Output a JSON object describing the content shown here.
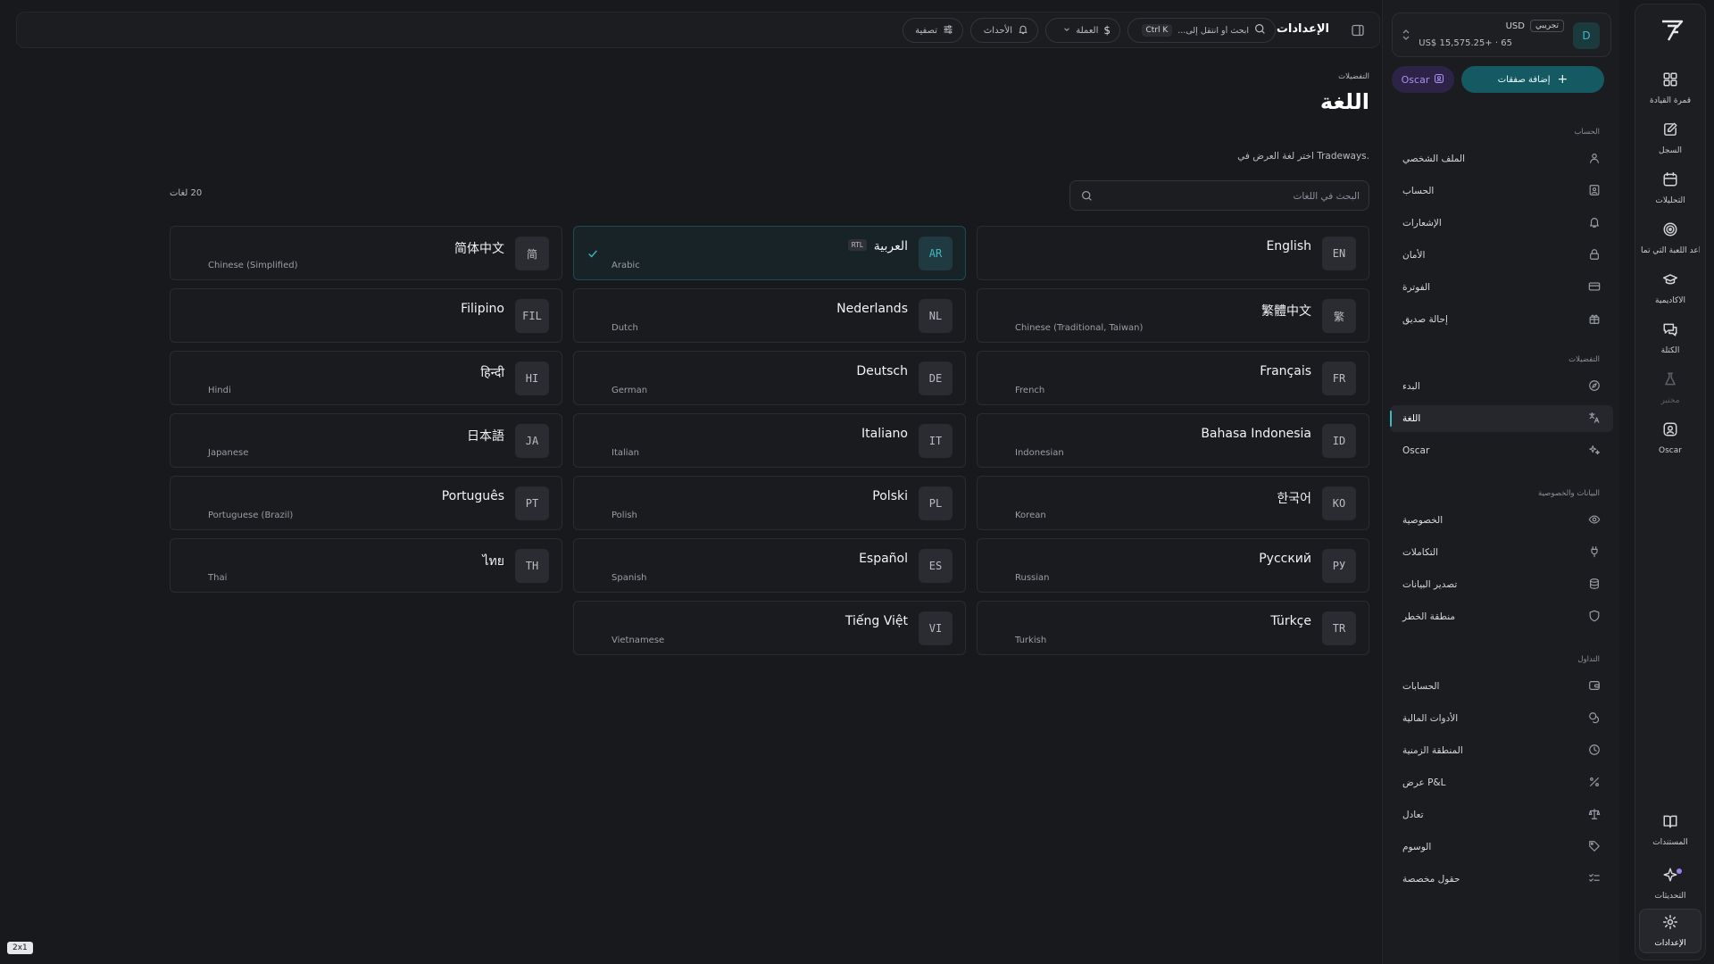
{
  "app": {
    "logo": "tradeways-logo"
  },
  "topbar": {
    "title": "الإعدادات",
    "search_placeholder": "ابحث أو انتقل إلى...",
    "search_shortcut": "Ctrl K",
    "currency_label": "العملة",
    "events_label": "الأحداث",
    "filter_label": "تصفية"
  },
  "rail": {
    "items": [
      {
        "label": "قمرة القيادة",
        "icon": "dashboard-icon"
      },
      {
        "label": "السجل",
        "icon": "journal-icon"
      },
      {
        "label": "التحليلات",
        "icon": "calendar-icon"
      },
      {
        "label": "قواعد اللعبة التي تما...",
        "icon": "target-icon"
      },
      {
        "label": "الأكاديمية",
        "icon": "academy-icon"
      },
      {
        "label": "الكتلة",
        "icon": "chat-icon"
      },
      {
        "label": "مختبر",
        "icon": "flask-icon"
      },
      {
        "label": "Oscar",
        "icon": "oscar-icon"
      }
    ],
    "bottom": [
      {
        "label": "المستندات",
        "icon": "book-icon"
      },
      {
        "label": "التحديثات",
        "icon": "sparkle-icon"
      },
      {
        "label": "الإعدادات",
        "icon": "gear-icon"
      }
    ]
  },
  "account": {
    "avatar": "D",
    "badge": "تجريبي",
    "currency": "USD",
    "balance": "US$ 15,575.25+ · 65"
  },
  "sidebar": {
    "add_trade": "إضافة صفقات",
    "oscar": "Oscar",
    "sections": [
      {
        "title": "الحساب",
        "items": [
          {
            "label": "الملف الشخصي",
            "icon": "user-icon"
          },
          {
            "label": "الحساب",
            "icon": "id-card-icon"
          },
          {
            "label": "الإشعارات",
            "icon": "bell-icon"
          },
          {
            "label": "الأمان",
            "icon": "lock-icon"
          },
          {
            "label": "الفوترة",
            "icon": "credit-card-icon"
          },
          {
            "label": "إحالة صديق",
            "icon": "gift-icon"
          }
        ]
      },
      {
        "title": "التفضيلات",
        "items": [
          {
            "label": "البدء",
            "icon": "compass-icon"
          },
          {
            "label": "اللغة",
            "icon": "translate-icon"
          },
          {
            "label": "Oscar",
            "icon": "sparkles-icon"
          }
        ]
      },
      {
        "title": "البيانات والخصوصية",
        "items": [
          {
            "label": "الخصوصية",
            "icon": "eye-icon"
          },
          {
            "label": "التكاملات",
            "icon": "plug-icon"
          },
          {
            "label": "تصدير البيانات",
            "icon": "database-icon"
          },
          {
            "label": "منطقة الخطر",
            "icon": "shield-icon"
          }
        ]
      },
      {
        "title": "التداول",
        "items": [
          {
            "label": "الحسابات",
            "icon": "wallet-icon"
          },
          {
            "label": "الأدوات المالية",
            "icon": "coins-icon"
          },
          {
            "label": "المنطقة الزمنية",
            "icon": "clock-icon"
          },
          {
            "label": "عرض P&L",
            "icon": "percent-icon"
          },
          {
            "label": "تعادل",
            "icon": "scale-icon"
          },
          {
            "label": "الوسوم",
            "icon": "tag-icon"
          },
          {
            "label": "حقول مخصصة",
            "icon": "list-check-icon"
          }
        ]
      }
    ]
  },
  "main": {
    "breadcrumb": "التفضيلات",
    "title": "اللغة",
    "description": "اختر لغة العرض في Tradeways.",
    "search_placeholder": "البحث في اللغات",
    "count": "20 لغات",
    "rtl_badge": "RTL",
    "languages": [
      {
        "code": "EN",
        "native": "English",
        "english": ""
      },
      {
        "code": "AR",
        "native": "العربية",
        "english": "Arabic",
        "selected": true,
        "rtl": true
      },
      {
        "code": "简",
        "native": "简体中文",
        "english": "Chinese (Simplified)"
      },
      {
        "code": "繁",
        "native": "繁體中文",
        "english": "Chinese (Traditional, Taiwan)"
      },
      {
        "code": "NL",
        "native": "Nederlands",
        "english": "Dutch"
      },
      {
        "code": "FIL",
        "native": "Filipino",
        "english": ""
      },
      {
        "code": "FR",
        "native": "Français",
        "english": "French"
      },
      {
        "code": "DE",
        "native": "Deutsch",
        "english": "German"
      },
      {
        "code": "HI",
        "native": "हिन्दी",
        "english": "Hindi"
      },
      {
        "code": "ID",
        "native": "Bahasa Indonesia",
        "english": "Indonesian"
      },
      {
        "code": "IT",
        "native": "Italiano",
        "english": "Italian"
      },
      {
        "code": "JA",
        "native": "日本語",
        "english": "Japanese"
      },
      {
        "code": "KO",
        "native": "한국어",
        "english": "Korean"
      },
      {
        "code": "PL",
        "native": "Polski",
        "english": "Polish"
      },
      {
        "code": "PT",
        "native": "Português",
        "english": "Portuguese (Brazil)"
      },
      {
        "code": "РУ",
        "native": "Русский",
        "english": "Russian"
      },
      {
        "code": "ES",
        "native": "Español",
        "english": "Spanish"
      },
      {
        "code": "TH",
        "native": "ไทย",
        "english": "Thai"
      },
      {
        "code": "TR",
        "native": "Türkçe",
        "english": "Turkish"
      },
      {
        "code": "VI",
        "native": "Tiếng Việt",
        "english": "Vietnamese"
      }
    ]
  },
  "footer": {
    "badge": "2x1"
  },
  "colors": {
    "accent": "#3fb8c4",
    "primary_button": "#155a63",
    "oscar": "#a98ff5"
  }
}
